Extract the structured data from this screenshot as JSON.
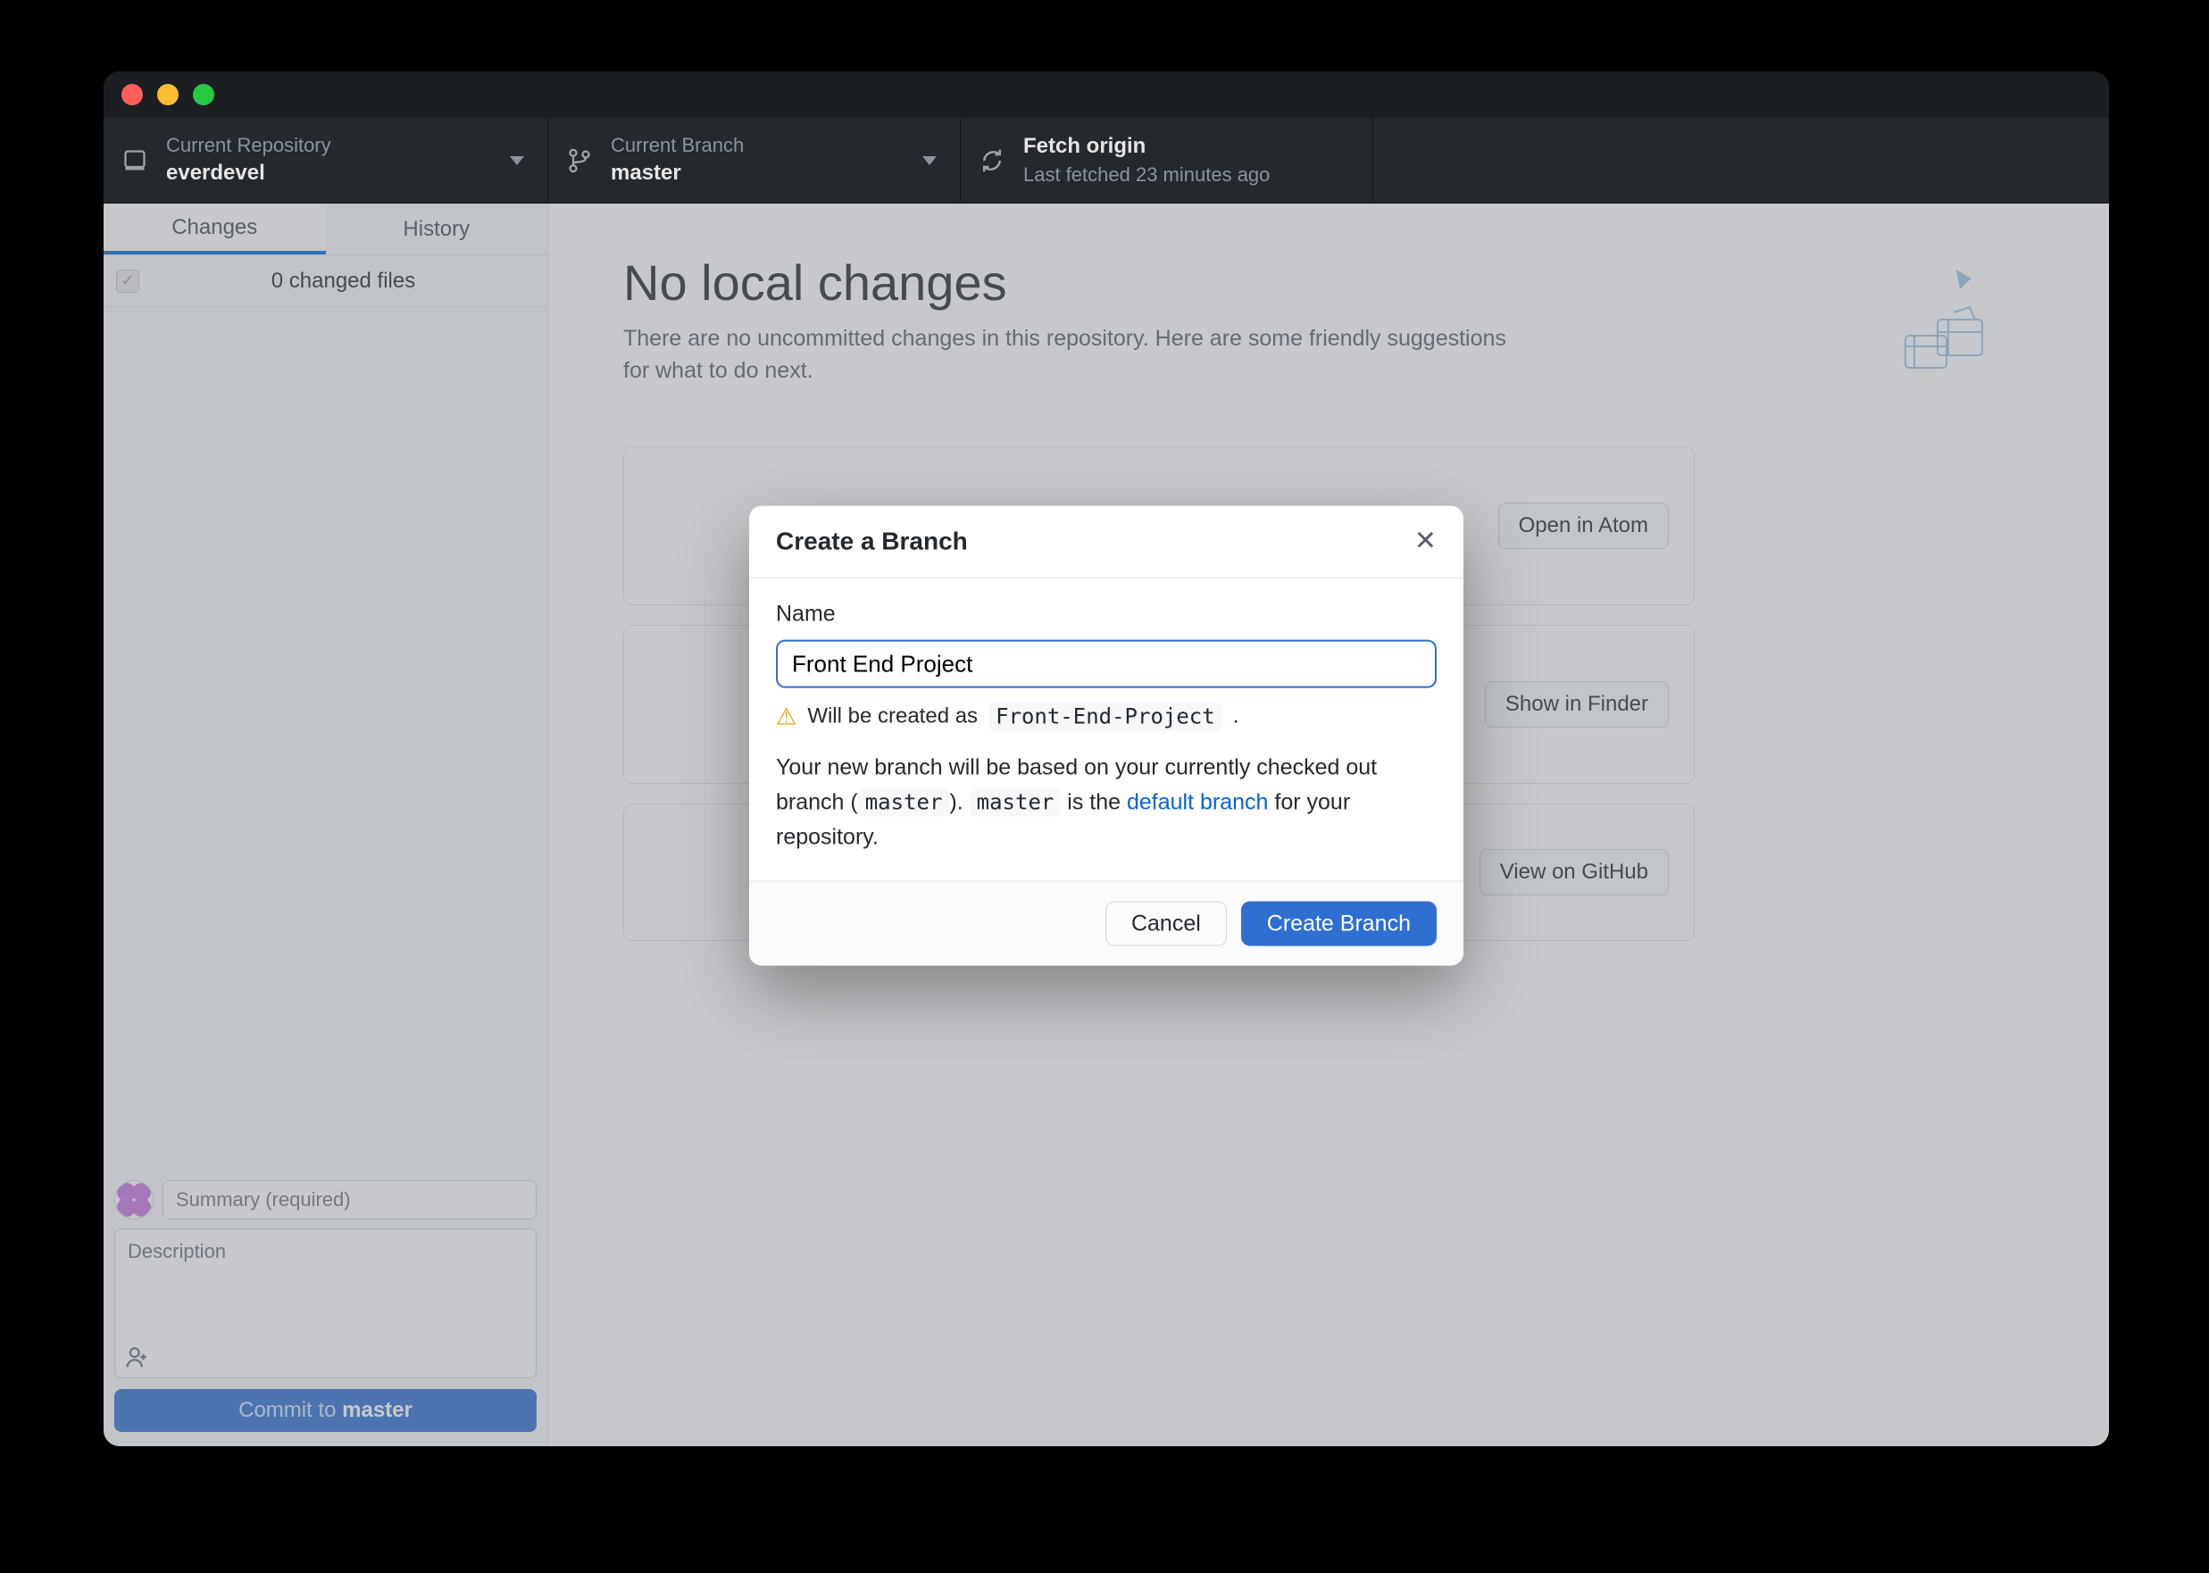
{
  "toolbar": {
    "repo": {
      "label": "Current Repository",
      "value": "everdevel"
    },
    "branch": {
      "label": "Current Branch",
      "value": "master"
    },
    "fetch": {
      "label": "Fetch origin",
      "value": "Last fetched 23 minutes ago"
    }
  },
  "sidebar": {
    "tabs": {
      "changes": "Changes",
      "history": "History"
    },
    "files_count_text": "0 changed files",
    "summary_placeholder": "Summary (required)",
    "description_placeholder": "Description",
    "commit_prefix": "Commit to ",
    "commit_branch": "master"
  },
  "main": {
    "heading": "No local changes",
    "subtitle": "There are no uncommitted changes in this repository. Here are some friendly suggestions for what to do next.",
    "buttons": {
      "open_editor": "Open in Atom",
      "show_finder": "Show in Finder",
      "view_github": "View on GitHub"
    }
  },
  "dialog": {
    "title": "Create a Branch",
    "name_label": "Name",
    "name_value": "Front End Project",
    "hint_prefix": "Will be created as",
    "hint_slug": "Front-End-Project",
    "hint_suffix": ".",
    "desc_1": "Your new branch will be based on your currently checked out branch (",
    "desc_code1": "master",
    "desc_2": "). ",
    "desc_code2": "master",
    "desc_3": " is the ",
    "desc_link": "default branch",
    "desc_4": " for your repository.",
    "cancel": "Cancel",
    "create": "Create Branch"
  }
}
